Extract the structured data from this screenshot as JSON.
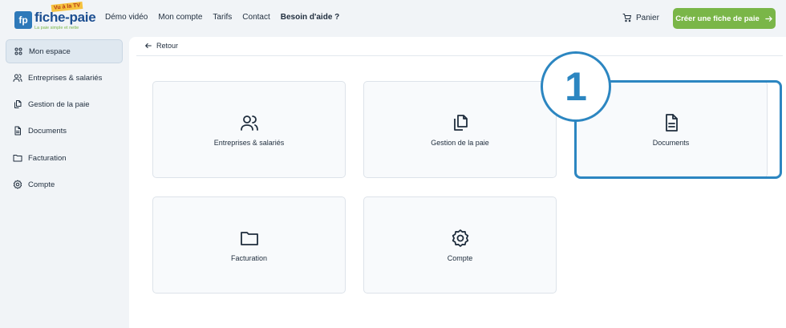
{
  "header": {
    "logo": {
      "mark": "fp",
      "brand": "fiche-paie",
      "badge": "Vu à la TV",
      "slogan": "La paie simple et nette"
    },
    "nav": [
      "Démo vidéo",
      "Mon compte",
      "Tarifs",
      "Contact",
      "Besoin d'aide ?"
    ],
    "cart_label": "Panier",
    "cta_label": "Créer une fiche de paie",
    "accent_color": "#7ab648"
  },
  "sidebar": {
    "items": [
      {
        "label": "Mon espace",
        "icon": "grid-icon",
        "active": true
      },
      {
        "label": "Entreprises & salariés",
        "icon": "users-icon"
      },
      {
        "label": "Gestion de la paie",
        "icon": "copy-document-icon"
      },
      {
        "label": "Documents",
        "icon": "document-icon"
      },
      {
        "label": "Facturation",
        "icon": "folder-icon"
      },
      {
        "label": "Compte",
        "icon": "gear-icon"
      }
    ]
  },
  "main": {
    "back_label": "Retour",
    "cards": [
      {
        "label": "Entreprises & salariés",
        "icon": "users-icon"
      },
      {
        "label": "Gestion de la paie",
        "icon": "copy-document-icon"
      },
      {
        "label": "Documents",
        "icon": "document-icon",
        "highlighted": true
      },
      {
        "label": "Facturation",
        "icon": "folder-icon"
      },
      {
        "label": "Compte",
        "icon": "gear-icon"
      }
    ]
  },
  "annotation": {
    "step_number": "1",
    "color": "#2c86c1"
  }
}
